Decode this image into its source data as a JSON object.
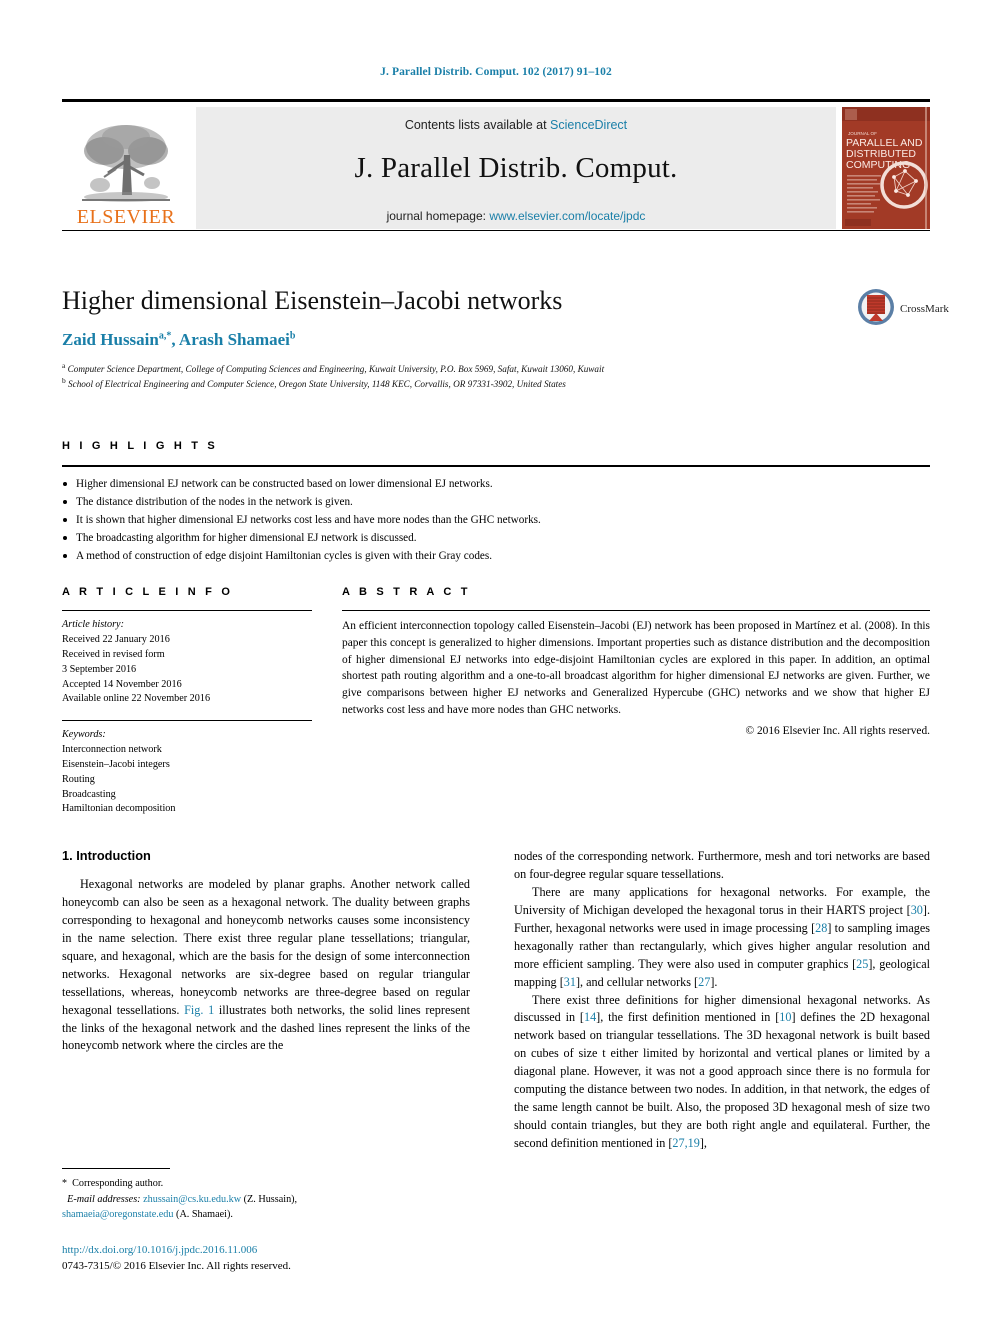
{
  "running_head": "J. Parallel Distrib. Comput. 102 (2017) 91–102",
  "masthead": {
    "publisher_name": "ELSEVIER",
    "contents_prefix": "Contents lists available at ",
    "contents_link": "ScienceDirect",
    "journal_name": "J. Parallel Distrib. Comput.",
    "homepage_prefix": "journal homepage: ",
    "homepage_link": "www.elsevier.com/locate/jpdc",
    "cover_title_lines": [
      "JOURNAL OF",
      "PARALLEL AND",
      "DISTRIBUTED",
      "COMPUTING"
    ]
  },
  "title": "Higher dimensional Eisenstein–Jacobi networks",
  "authors": {
    "author1_name": "Zaid Hussain",
    "author1_sup": "a,*",
    "separator": ", ",
    "author2_name": "Arash Shamaei",
    "author2_sup": "b"
  },
  "affiliations": [
    {
      "sup": "a",
      "text": "Computer Science Department, College of Computing Sciences and Engineering, Kuwait University, P.O. Box 5969, Safat, Kuwait 13060, Kuwait"
    },
    {
      "sup": "b",
      "text": "School of Electrical Engineering and Computer Science, Oregon State University, 1148 KEC, Corvallis, OR 97331-3902, United States"
    }
  ],
  "crossmark_label": "CrossMark",
  "highlights": {
    "heading": "H I G H L I G H T S",
    "items": [
      "Higher dimensional EJ network can be constructed based on lower dimensional EJ networks.",
      "The distance distribution of the nodes in the network is given.",
      "It is shown that higher dimensional EJ networks cost less and have more nodes than the GHC networks.",
      "The broadcasting algorithm for higher dimensional EJ network is discussed.",
      "A method of construction of edge disjoint Hamiltonian cycles is given with their Gray codes."
    ]
  },
  "article_info": {
    "heading": "A R T I C L E    I N F O",
    "history_label": "Article history:",
    "history_lines": [
      "Received 22 January 2016",
      "Received in revised form",
      "3 September 2016",
      "Accepted 14 November 2016",
      "Available online 22 November 2016"
    ],
    "keywords_label": "Keywords:",
    "keywords": [
      "Interconnection network",
      "Eisenstein–Jacobi integers",
      "Routing",
      "Broadcasting",
      "Hamiltonian decomposition"
    ]
  },
  "abstract": {
    "heading": "A B S T R A C T",
    "text": "An efficient interconnection topology called Eisenstein–Jacobi (EJ) network has been proposed in Martínez et al. (2008). In this paper this concept is generalized to higher dimensions. Important properties such as distance distribution and the decomposition of higher dimensional EJ networks into edge-disjoint Hamiltonian cycles are explored in this paper. In addition, an optimal shortest path routing algorithm and a one-to-all broadcast algorithm for higher dimensional EJ networks are given. Further, we give comparisons between higher EJ networks and Generalized Hypercube (GHC) networks and we show that higher EJ networks cost less and have more nodes than GHC networks.",
    "copyright": "© 2016 Elsevier Inc. All rights reserved."
  },
  "body": {
    "section_heading": "1. Introduction",
    "left_paragraphs": [
      "Hexagonal networks are modeled by planar graphs. Another network called honeycomb can also be seen as a hexagonal network. The duality between graphs corresponding to hexagonal and honeycomb networks causes some inconsistency in the name selection. There exist three regular plane tessellations; triangular, square, and hexagonal, which are the basis for the design of some interconnection networks. Hexagonal networks are six-degree based on regular triangular tessellations, whereas, honeycomb networks are three-degree based on regular hexagonal tessellations. Fig. 1 illustrates both networks, the solid lines represent the links of the hexagonal network and the dashed lines represent the links of the honeycomb network where the circles are the"
    ],
    "right_paragraphs": [
      "nodes of the corresponding network. Furthermore, mesh and tori networks are based on four-degree regular square tessellations.",
      "There are many applications for hexagonal networks. For example, the University of Michigan developed the hexagonal torus in their HARTS project [30]. Further, hexagonal networks were used in image processing [28] to sampling images hexagonally rather than rectangularly, which gives higher angular resolution and more efficient sampling. They were also used in computer graphics [25], geological mapping [31], and cellular networks [27].",
      "There exist three definitions for higher dimensional hexagonal networks. As discussed in [14], the first definition mentioned in [10] defines the 2D hexagonal network based on triangular tessellations. The 3D hexagonal network is built based on cubes of size t either limited by horizontal and vertical planes or limited by a diagonal plane. However, it was not a good approach since there is no formula for computing the distance between two nodes. In addition, in that network, the edges of the same length cannot be built. Also, the proposed 3D hexagonal mesh of size two should contain triangles, but they are both right angle and equilateral. Further, the second definition mentioned in [27,19],"
    ],
    "inline_links": [
      "Fig. 1",
      "30",
      "28",
      "25",
      "31",
      "27",
      "14",
      "10",
      "27,19"
    ]
  },
  "footnotes": {
    "corresponding_author": "Corresponding author.",
    "email_label": "E-mail addresses:",
    "email1": "zhussain@cs.ku.edu.kw",
    "email1_owner": "(Z. Hussain),",
    "email2": "shamaeia@oregonstate.edu",
    "email2_owner": "(A. Shamaei)."
  },
  "doi_block": {
    "doi": "http://dx.doi.org/10.1016/j.jpdc.2016.11.006",
    "issn_copyright": "0743-7315/© 2016 Elsevier Inc. All rights reserved."
  },
  "colors": {
    "link_blue": "#1a7fa8",
    "elsevier_orange": "#E8711A",
    "masthead_grey": "#ececec",
    "cover_red": "#9c3322"
  }
}
